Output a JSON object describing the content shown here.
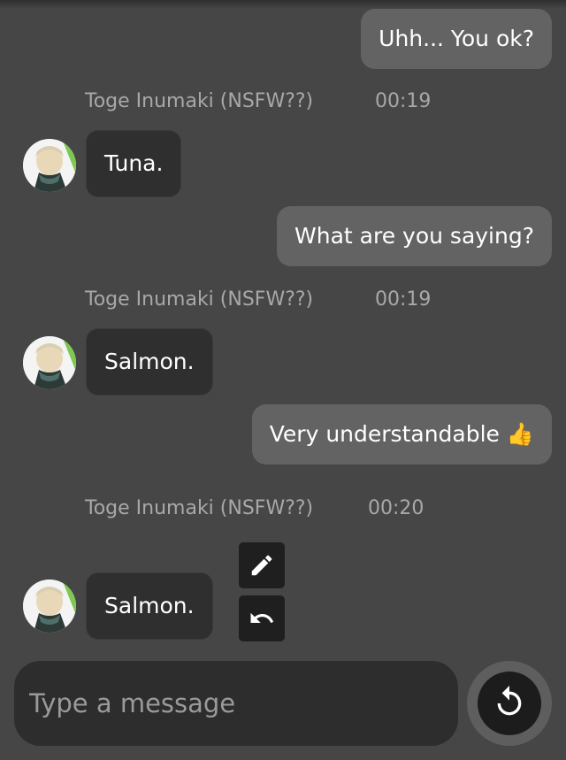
{
  "messages": [
    {
      "type": "out",
      "text": "Uhh... You ok?"
    },
    {
      "type": "in",
      "sender": "Toge Inumaki (NSFW??)",
      "time": "00:19",
      "text": "Tuna.",
      "avatar_icon": "character-avatar-icon"
    },
    {
      "type": "out",
      "text": "What are you saying?"
    },
    {
      "type": "in",
      "sender": "Toge Inumaki (NSFW??)",
      "time": "00:19",
      "text": "Salmon.",
      "avatar_icon": "character-avatar-icon"
    },
    {
      "type": "out",
      "text": "Very understandable 👍"
    },
    {
      "type": "in",
      "sender": "Toge Inumaki (NSFW??)",
      "time": "00:20",
      "text": "Salmon.",
      "avatar_icon": "character-avatar-icon"
    }
  ],
  "message_tools": {
    "edit_icon": "pencil-icon",
    "undo_icon": "undo-icon"
  },
  "composer": {
    "placeholder": "Type a message",
    "action_icon": "regenerate-icon"
  },
  "colors": {
    "background": "#464646",
    "outgoing_bubble": "#636363",
    "incoming_bubble": "#2f2f2f",
    "meta_text": "#a8a8a8"
  }
}
